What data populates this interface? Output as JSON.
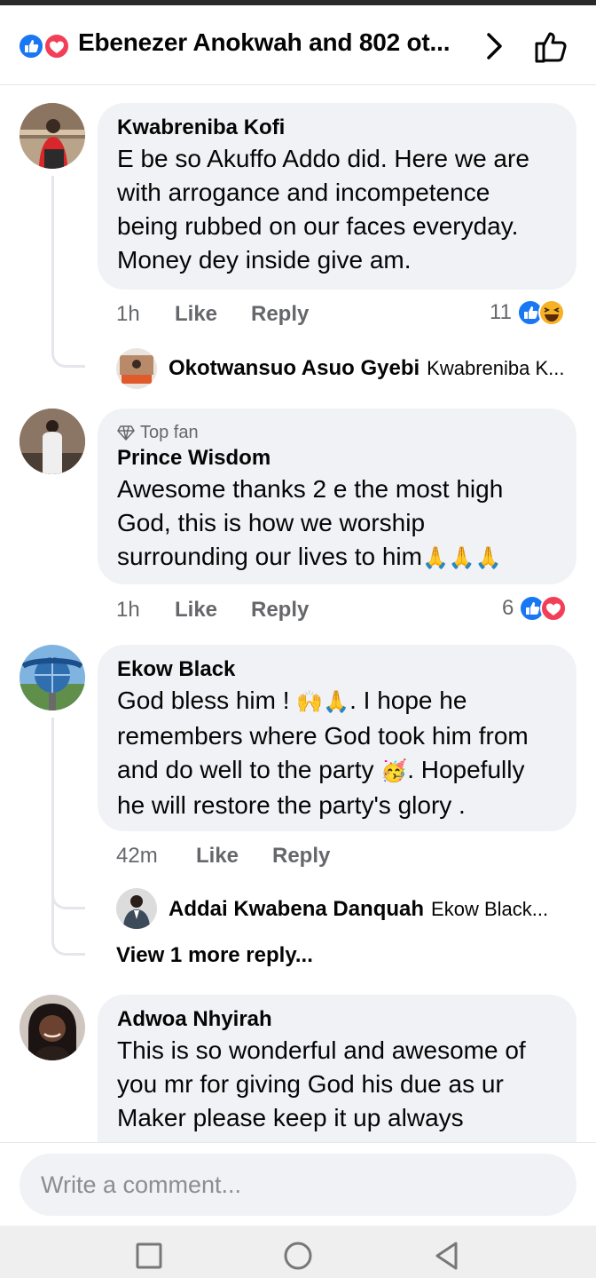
{
  "header": {
    "title": "Ebenezer Anokwah and 802 ot...",
    "reaction_icons": [
      "like-icon",
      "love-icon"
    ]
  },
  "comments": [
    {
      "author": "Kwabreniba Kofi",
      "text": "E be so Akuffo Addo did. Here we are with arrogance and incompetence being rubbed on our faces everyday. Money dey inside give am.",
      "time": "1h",
      "like_label": "Like",
      "reply_label": "Reply",
      "reaction_count": "11",
      "reactions": [
        "like-icon",
        "haha-icon"
      ],
      "reply_preview": {
        "name": "Okotwansuo Asuo Gyebi",
        "snippet": "Kwabreniba K..."
      }
    },
    {
      "badge": "Top fan",
      "author": "Prince Wisdom",
      "text": "Awesome thanks 2 e the most high God, this is how we worship surrounding our lives to him",
      "emoji": "🙏🙏🙏",
      "time": "1h",
      "like_label": "Like",
      "reply_label": "Reply",
      "reaction_count": "6",
      "reactions": [
        "like-icon",
        "love-icon"
      ]
    },
    {
      "author": "Ekow Black",
      "text_a": "God bless him ! ",
      "emoji_a": "🙌🙏",
      "text_b": ". I hope he remembers where God took him from and do well to the party ",
      "emoji_b": "🥳",
      "text_c": ". Hopefully he will restore the party's glory .",
      "time": "42m",
      "like_label": "Like",
      "reply_label": "Reply",
      "reply_preview": {
        "name": "Addai Kwabena Danquah",
        "snippet": "Ekow Black..."
      },
      "more_replies": "View 1 more reply..."
    },
    {
      "author": "Adwoa Nhyirah",
      "text": "This is so wonderful and awesome of you mr for giving God his due as ur Maker please keep it up always"
    }
  ],
  "composer": {
    "placeholder": "Write a comment..."
  },
  "colors": {
    "facebook_blue": "#1877f2",
    "love_red": "#f33e58",
    "haha_yellow": "#f7b125",
    "bubble_bg": "#f0f2f5",
    "meta_gray": "#65676b"
  },
  "system_nav": [
    "recent-apps-icon",
    "home-icon",
    "back-icon"
  ]
}
